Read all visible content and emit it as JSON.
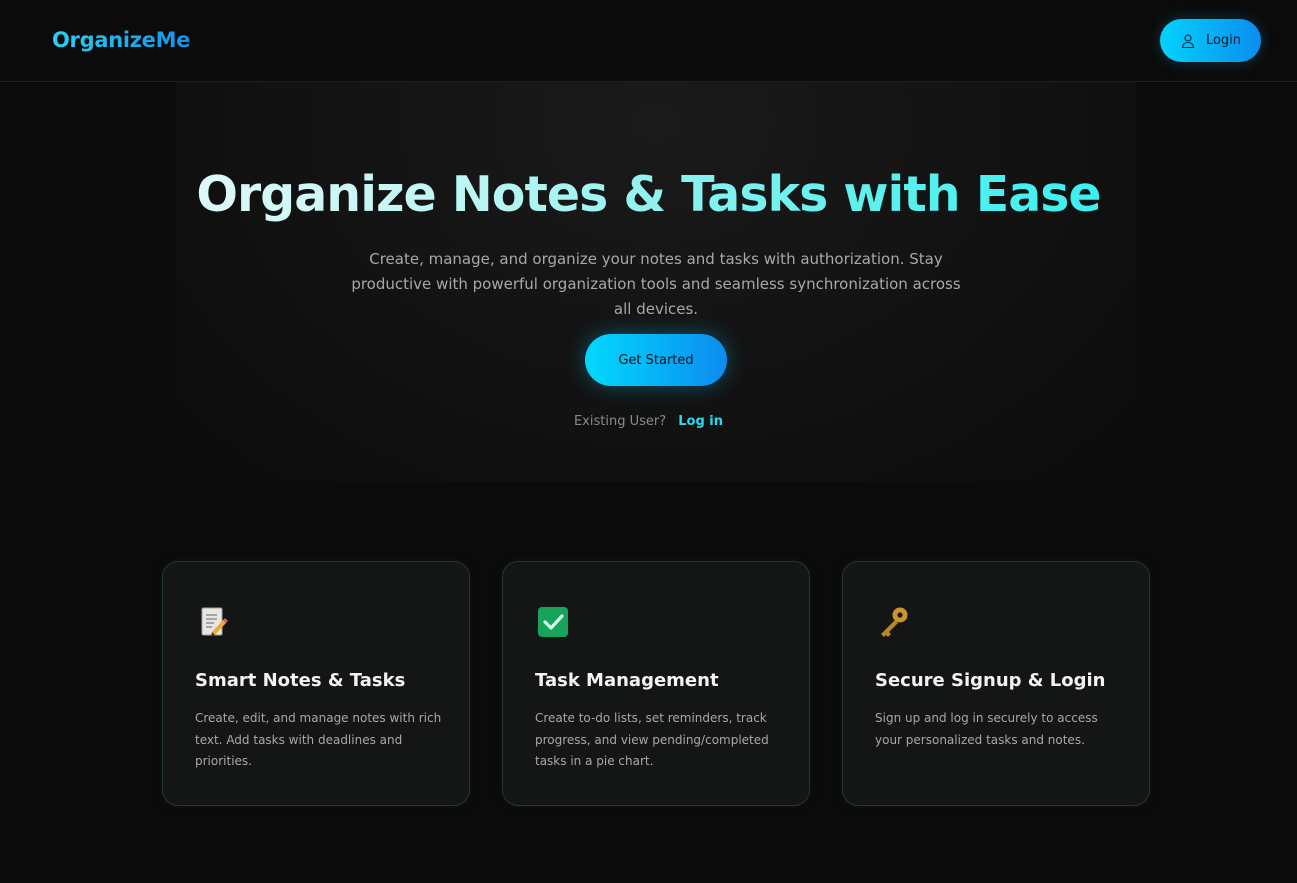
{
  "nav": {
    "brand": "OrganizeMe",
    "login_label": "Login"
  },
  "hero": {
    "title": "Organize Notes & Tasks with Ease",
    "subtitle": "Create, manage, and organize your notes and tasks with authorization. Stay productive with powerful organization tools and seamless synchronization across all devices.",
    "cta_label": "Get Started",
    "existing_prompt": "Existing User?",
    "existing_link": "Log in"
  },
  "features": [
    {
      "icon": "memo-icon",
      "title": "Smart Notes & Tasks",
      "text": "Create, edit, and manage notes with rich text. Add tasks with deadlines and priorities."
    },
    {
      "icon": "checkmark-icon",
      "title": "Task Management",
      "text": "Create to-do lists, set reminders, track progress, and view pending/completed tasks in a pie chart."
    },
    {
      "icon": "key-icon",
      "title": "Secure Signup & Login",
      "text": "Sign up and log in securely to access your personalized tasks and notes."
    }
  ],
  "colors": {
    "accent": "#03d9fc",
    "accent_dark": "#0b8cef",
    "background": "#0b0b0b",
    "card_bg": "#141515",
    "card_border": "#263632"
  }
}
